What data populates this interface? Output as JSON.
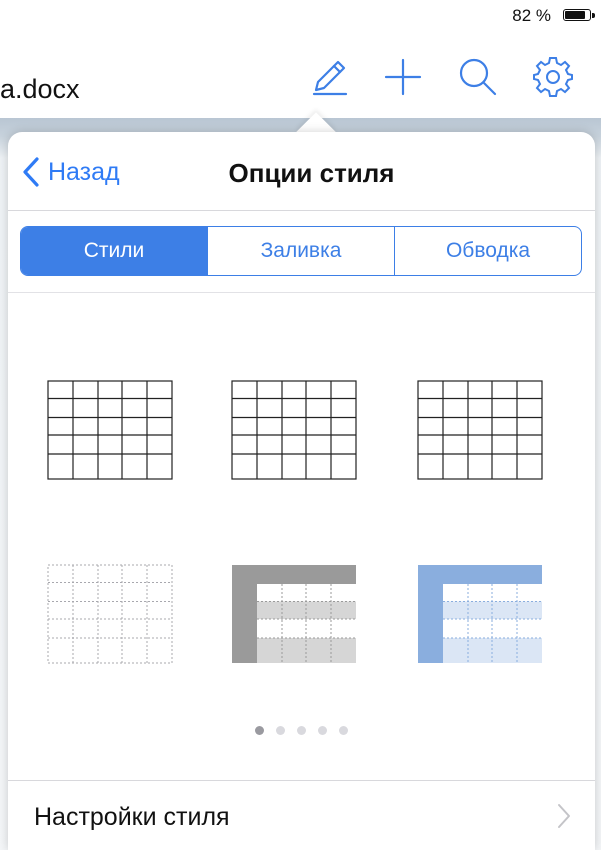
{
  "status_bar": {
    "battery_text": "82 %"
  },
  "nav": {
    "doc_title": "a.docx",
    "icons": [
      "pencil-icon",
      "plus-icon",
      "search-icon",
      "gear-icon"
    ]
  },
  "popover": {
    "back_label": "Назад",
    "title": "Опции стиля",
    "tabs": [
      {
        "label": "Стили",
        "active": true
      },
      {
        "label": "Заливка",
        "active": false
      },
      {
        "label": "Обводка",
        "active": false
      }
    ],
    "table_styles": [
      "plain-grid-black",
      "plain-grid-black",
      "plain-grid-black",
      "dotted-grid-light",
      "gray-header-banded",
      "blue-header-banded"
    ],
    "page_dots": {
      "count": 5,
      "active_index": 0
    },
    "settings_label": "Настройки стиля"
  },
  "colors": {
    "accent": "#3d7fe6",
    "link": "#2f7bf5",
    "gray_header": "#9a9a9a",
    "gray_band": "#d6d6d6",
    "blue_header": "#8aaede",
    "blue_band": "#dbe6f5"
  }
}
